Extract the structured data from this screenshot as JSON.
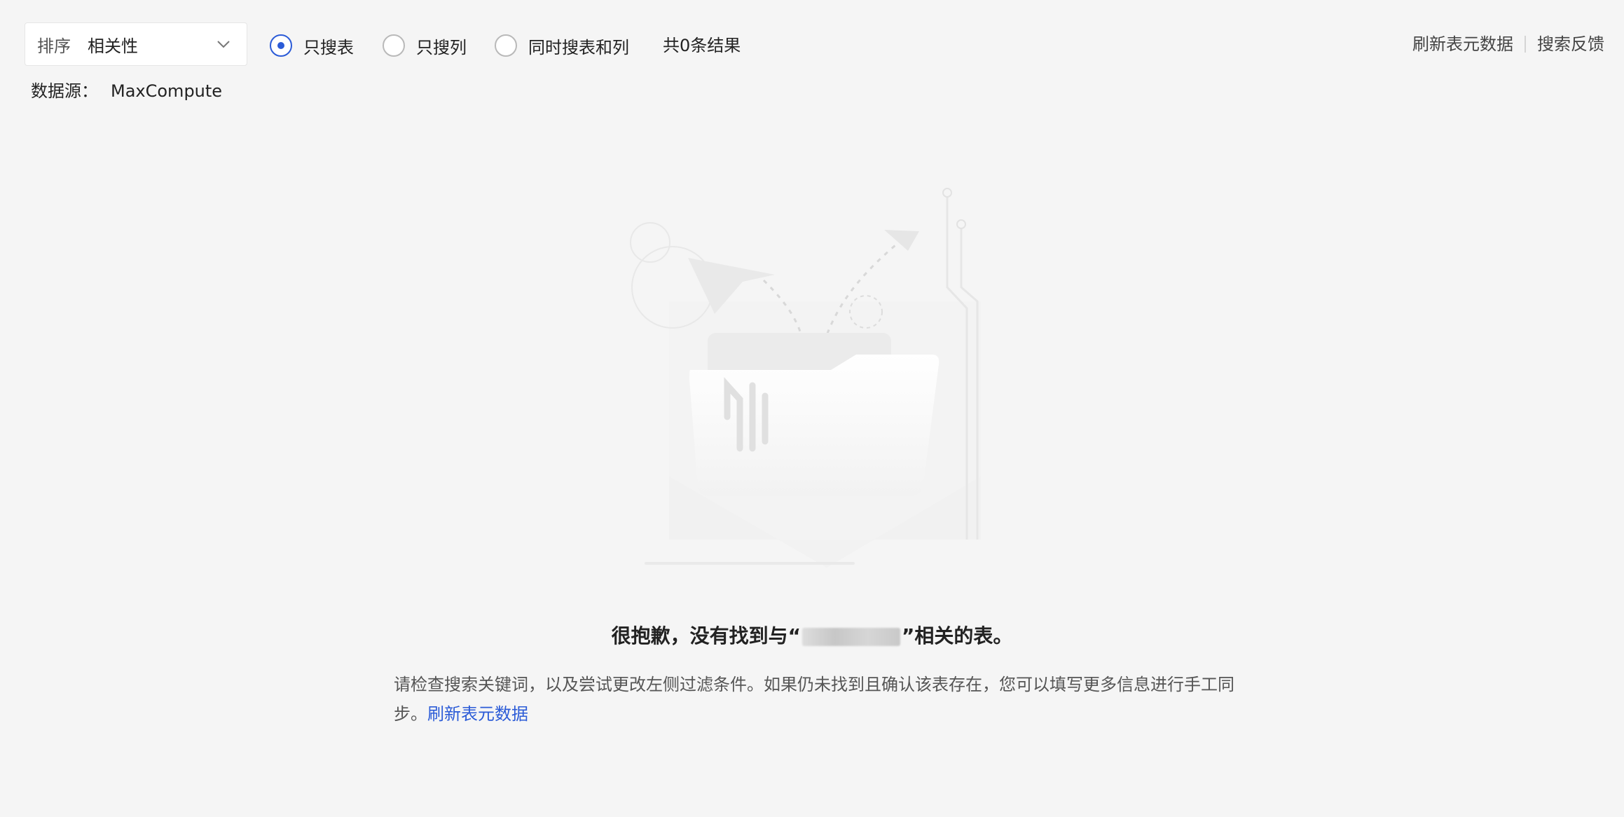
{
  "sort": {
    "label": "排序",
    "value": "相关性"
  },
  "radios": [
    {
      "label": "只搜表",
      "checked": true
    },
    {
      "label": "只搜列",
      "checked": false
    },
    {
      "label": "同时搜表和列",
      "checked": false
    }
  ],
  "result_count": "共0条结果",
  "top_links": {
    "refresh": "刷新表元数据",
    "feedback": "搜索反馈"
  },
  "datasource": {
    "label": "数据源：",
    "value": "MaxCompute"
  },
  "empty": {
    "title_prefix": "很抱歉，没有找到与“",
    "title_suffix": "”相关的表。",
    "desc": "请检查搜索关键词，以及尝试更改左侧过滤条件。如果仍未找到且确认该表存在，您可以填写更多信息进行手工同步。",
    "link": "刷新表元数据"
  },
  "colors": {
    "accent": "#2b5bd7",
    "background": "#f5f5f5"
  },
  "icons": [
    "chevron-down-icon",
    "empty-folder-illustration"
  ]
}
